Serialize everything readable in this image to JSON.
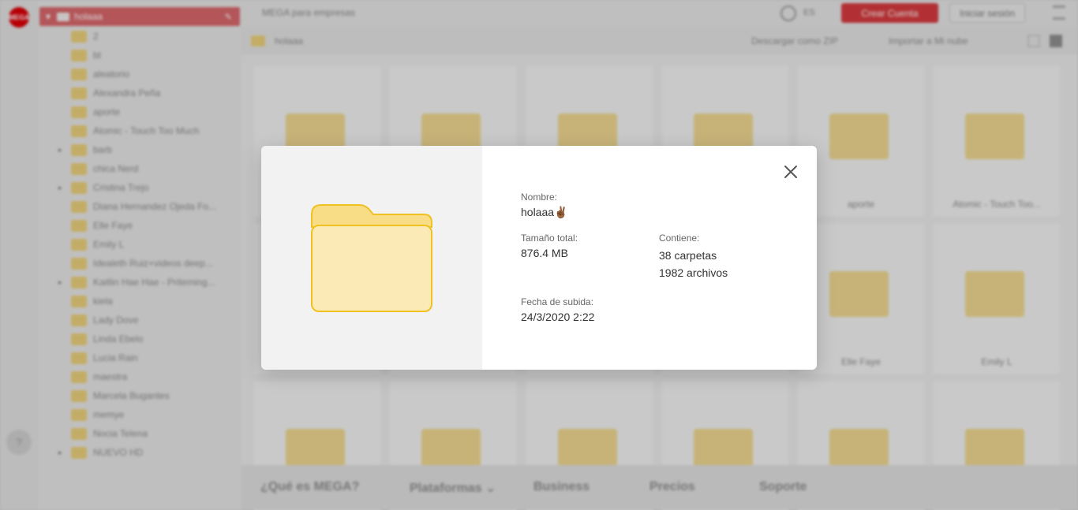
{
  "app": {
    "logo_text": "MEGA",
    "topbar": {
      "business_link": "MEGA para empresas",
      "language": "ES",
      "create_account": "Crear Cuenta",
      "login": "Iniciar sesión"
    },
    "breadcrumb": {
      "folder": "holaaa"
    },
    "actions": {
      "download_zip": "Descargar como ZIP",
      "import_cloud": "Importar a Mi nube"
    }
  },
  "tree": {
    "root_label": "holaaa",
    "items": [
      {
        "label": "2",
        "expandable": false
      },
      {
        "label": "bt",
        "expandable": false
      },
      {
        "label": "aleatorio",
        "expandable": false
      },
      {
        "label": "Alexandra Peña",
        "expandable": false
      },
      {
        "label": "aporte",
        "expandable": false
      },
      {
        "label": "Atomic - Touch Too Much",
        "expandable": false
      },
      {
        "label": "barb",
        "expandable": true
      },
      {
        "label": "chica Nerd",
        "expandable": false
      },
      {
        "label": "Cristina Trejo",
        "expandable": true
      },
      {
        "label": "Diana Hernandez Ojeda Fo...",
        "expandable": false
      },
      {
        "label": "Elle Faye",
        "expandable": false
      },
      {
        "label": "Emily L",
        "expandable": false
      },
      {
        "label": "Idealeth Ruiz+videos deep...",
        "expandable": false
      },
      {
        "label": "Kaitlin Hae Hae - Priteming...",
        "expandable": true
      },
      {
        "label": "kiela",
        "expandable": false
      },
      {
        "label": "Lady Dove",
        "expandable": false
      },
      {
        "label": "Linda Ebelo",
        "expandable": false
      },
      {
        "label": "Lucia Rain",
        "expandable": false
      },
      {
        "label": "maestra",
        "expandable": false
      },
      {
        "label": "Marcela Bugantes",
        "expandable": false
      },
      {
        "label": "memye",
        "expandable": false
      },
      {
        "label": "Nocia Telena",
        "expandable": false
      },
      {
        "label": "NUEVO HD",
        "expandable": true
      }
    ]
  },
  "grid": {
    "tiles": [
      {
        "name": ""
      },
      {
        "name": ""
      },
      {
        "name": ""
      },
      {
        "name": ""
      },
      {
        "name": "aporte"
      },
      {
        "name": "Atomic - Touch Too..."
      },
      {
        "name": ""
      },
      {
        "name": ""
      },
      {
        "name": ""
      },
      {
        "name": ""
      },
      {
        "name": "Elle Faye"
      },
      {
        "name": "Emily L"
      },
      {
        "name": ""
      },
      {
        "name": ""
      },
      {
        "name": ""
      },
      {
        "name": ""
      },
      {
        "name": ""
      },
      {
        "name": ""
      }
    ]
  },
  "footer": {
    "links": [
      "¿Qué es MEGA?",
      "Plataformas ⌄",
      "Business",
      "Precios",
      "Soporte"
    ]
  },
  "modal": {
    "name_label": "Nombre:",
    "name_value": "holaaa",
    "name_emoji": "✌🏾",
    "size_label": "Tamaño total:",
    "size_value": "876.4 MB",
    "contains_label": "Contiene:",
    "folders_count": "38 carpetas",
    "files_count": "1982 archivos",
    "date_label": "Fecha de subida:",
    "date_value": "24/3/2020 2:22",
    "icon": "folder-icon",
    "close_icon": "close-icon"
  },
  "colors": {
    "brand_red": "#d90007",
    "folder_fill": "#fbeab5",
    "folder_tab": "#f9dc86",
    "folder_stroke": "#f0c221"
  }
}
